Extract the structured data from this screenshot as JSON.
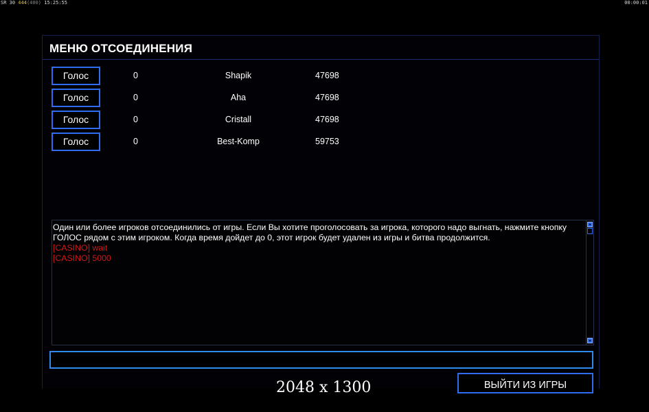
{
  "hud": {
    "left_prefix": "SR 30",
    "left_yellow": "444",
    "left_gray": "(400)",
    "left_time": "15:25:55",
    "right_time": "00:00:01"
  },
  "panel": {
    "title": "МЕНЮ ОТСОЕДИНЕНИЯ"
  },
  "players": [
    {
      "vote_label": "Голос",
      "votes": "0",
      "name": "Shapik",
      "score": "47698"
    },
    {
      "vote_label": "Голос",
      "votes": "0",
      "name": "Aha",
      "score": "47698"
    },
    {
      "vote_label": "Голос",
      "votes": "0",
      "name": "Cristall",
      "score": "47698"
    },
    {
      "vote_label": "Голос",
      "votes": "0",
      "name": "Best-Komp",
      "score": "59753"
    }
  ],
  "chat": {
    "system_line_1": "Один или более игроков отсоединились от игры. Если Вы хотите проголосовать за игрока, которого надо выгнать, нажмите кнопку",
    "system_line_2": " ГОЛОС рядом с этим игроком. Когда время дойдет до 0, этот игрок будет удален из игры и битва продолжится.",
    "messages": [
      "[CASINO] wait",
      "[CASINO] 5000"
    ],
    "message_color": "#d01818"
  },
  "input": {
    "value": "",
    "placeholder": ""
  },
  "exit_button": {
    "label": "ВЫЙТИ ИЗ ИГРЫ"
  },
  "resolution_text": "2048 x 1300",
  "accent_color": "#2f6cf0"
}
